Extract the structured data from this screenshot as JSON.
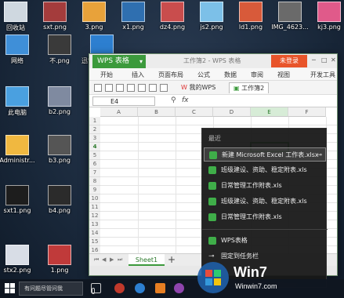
{
  "desktop": {
    "icons": [
      {
        "label": "回收站",
        "color": "#cfd8e0"
      },
      {
        "label": "sxt.png",
        "color": "#a43c3c"
      },
      {
        "label": "3.png",
        "color": "#e8a23a"
      },
      {
        "label": "x1.png",
        "color": "#2f6fb0"
      },
      {
        "label": "dz4.png",
        "color": "#c94d4d"
      },
      {
        "label": "js2.png",
        "color": "#7cc0e8"
      },
      {
        "label": "ld1.png",
        "color": "#d85a3a"
      },
      {
        "label": "IMG_4623...",
        "color": "#6a6a6a"
      },
      {
        "label": "kj3.png",
        "color": "#e05a8a"
      },
      {
        "label": "网络",
        "color": "#3f8fd8"
      },
      {
        "label": "不.png",
        "color": "#3a3a3a"
      },
      {
        "label": "迅雷看看播放器",
        "color": "#2d7fd0"
      },
      {
        "label": "此电脑",
        "color": "#4aa0e0"
      },
      {
        "label": "b2.png",
        "color": "#7f8aa0"
      },
      {
        "label": "Administr...",
        "color": "#f0b840"
      },
      {
        "label": "b3.png",
        "color": "#555555"
      },
      {
        "label": "sxt1.png",
        "color": "#1d1d1d"
      },
      {
        "label": "b4.png",
        "color": "#2b2b2b"
      },
      {
        "label": "stx2.png",
        "color": "#d8dde6"
      },
      {
        "label": "1.png",
        "color": "#c03a3a"
      }
    ]
  },
  "wps": {
    "app_tab": "WPS 表格",
    "doc_title": "工作簿2 - WPS 表格",
    "login_button": "未登录",
    "menu": [
      "开始",
      "插入",
      "页面布局",
      "公式",
      "数据",
      "审阅",
      "视图",
      "开发工具"
    ],
    "doc_tabs": [
      "我的WPS",
      "工作簿2"
    ],
    "name_box": "E4",
    "fx_label": "fx",
    "columns": [
      "A",
      "B",
      "C",
      "D",
      "E",
      "F"
    ],
    "rows": [
      "1",
      "2",
      "3",
      "4",
      "5",
      "6",
      "7",
      "8",
      "9",
      "10",
      "11",
      "12",
      "13",
      "14",
      "15",
      "16"
    ],
    "active_column": "E",
    "active_row": "4",
    "sheet_tab": "Sheet1",
    "add_sheet": "+"
  },
  "jumplist": {
    "heading": "最近",
    "recent": [
      "新建 Microsoft Excel 工作表.xlsx",
      "班级建设、资助、稳定附表.xls",
      "日常管理工作附表.xls",
      "班级建设、资助、稳定附表.xls",
      "日常管理工作附表.xls"
    ],
    "app_entry": "WPS表格",
    "pin_entry": "固定到任务栏"
  },
  "taskbar": {
    "search_placeholder": "有问题尽管问我"
  },
  "watermark": {
    "text": "Win7",
    "url": "Winwin7.com"
  },
  "colors": {
    "wps_green": "#3c9a3c",
    "login_orange": "#e8542a"
  }
}
